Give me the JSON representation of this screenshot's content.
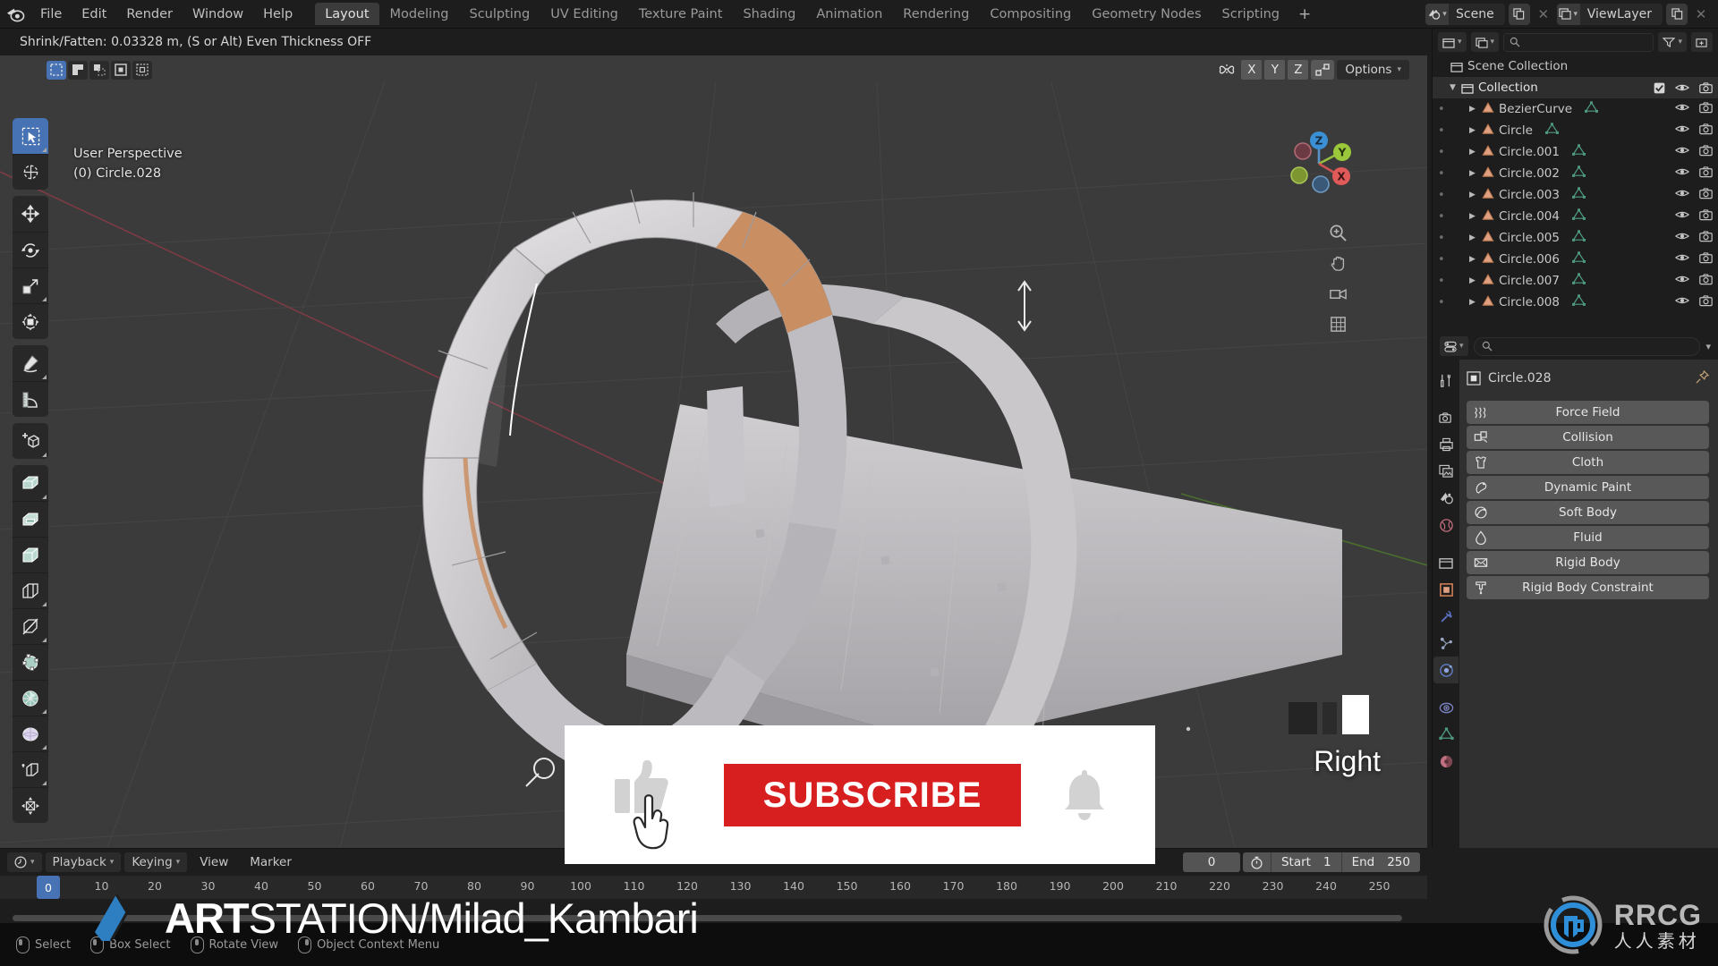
{
  "app": {
    "name": "Blender",
    "menus": [
      "File",
      "Edit",
      "Render",
      "Window",
      "Help"
    ],
    "workspace_tabs": [
      {
        "label": "Layout",
        "active": true
      },
      {
        "label": "Modeling",
        "active": false
      },
      {
        "label": "Sculpting",
        "active": false
      },
      {
        "label": "UV Editing",
        "active": false
      },
      {
        "label": "Texture Paint",
        "active": false
      },
      {
        "label": "Shading",
        "active": false
      },
      {
        "label": "Animation",
        "active": false
      },
      {
        "label": "Rendering",
        "active": false
      },
      {
        "label": "Compositing",
        "active": false
      },
      {
        "label": "Geometry Nodes",
        "active": false
      },
      {
        "label": "Scripting",
        "active": false
      }
    ],
    "add_workspace": "+",
    "scene_name": "Scene",
    "view_layer_name": "ViewLayer"
  },
  "viewport": {
    "operator_info": "Shrink/Fatten: 0.03328 m, (S or Alt) Even Thickness OFF",
    "perspective_label": "User Perspective",
    "object_label": "(0) Circle.028",
    "view_orientation_label": "Right",
    "header": {
      "axis_buttons": [
        "X",
        "Y",
        "Z"
      ],
      "options_label": "Options"
    },
    "select_modes": [
      "tweak",
      "select-box",
      "select-circle",
      "select-lasso"
    ],
    "tools": [
      "select-box-tool",
      "cursor-tool",
      "move-tool",
      "rotate-tool",
      "scale-tool",
      "transform-tool",
      "annotate-tool",
      "measure-tool",
      "add-cube-tool",
      "extrude-region-tool",
      "inset-faces-tool",
      "bevel-tool",
      "loop-cut-tool",
      "knife-tool",
      "poly-build-tool",
      "spin-tool",
      "smooth-tool",
      "edge-slide-tool",
      "shrink-fatten-tool"
    ],
    "gizmo_axes": [
      "Z",
      "Y",
      "X"
    ]
  },
  "outliner": {
    "root": "Scene Collection",
    "collection": "Collection",
    "items": [
      {
        "label": "BezierCurve",
        "type": "curve"
      },
      {
        "label": "Circle",
        "type": "curve"
      },
      {
        "label": "Circle.001",
        "type": "curve"
      },
      {
        "label": "Circle.002",
        "type": "curve"
      },
      {
        "label": "Circle.003",
        "type": "curve"
      },
      {
        "label": "Circle.004",
        "type": "curve"
      },
      {
        "label": "Circle.005",
        "type": "curve"
      },
      {
        "label": "Circle.006",
        "type": "curve"
      },
      {
        "label": "Circle.007",
        "type": "curve"
      },
      {
        "label": "Circle.008",
        "type": "curve"
      }
    ]
  },
  "properties": {
    "active_object": "Circle.028",
    "tabs": [
      "tool-tab",
      "render-tab",
      "output-tab",
      "view-layer-tab",
      "scene-tab",
      "world-tab",
      "collection-tab",
      "object-tab",
      "modifiers-tab",
      "particles-tab",
      "physics-tab",
      "constraints-tab",
      "data-tab",
      "material-tab"
    ],
    "active_tab": "physics-tab",
    "physics_buttons": [
      {
        "label": "Force Field",
        "icon": "force-field-icon"
      },
      {
        "label": "Collision",
        "icon": "collision-icon"
      },
      {
        "label": "Cloth",
        "icon": "cloth-icon"
      },
      {
        "label": "Dynamic Paint",
        "icon": "dynamic-paint-icon"
      },
      {
        "label": "Soft Body",
        "icon": "soft-body-icon"
      },
      {
        "label": "Fluid",
        "icon": "fluid-icon"
      },
      {
        "label": "Rigid Body",
        "icon": "rigid-body-icon"
      },
      {
        "label": "Rigid Body Constraint",
        "icon": "rigid-body-constraint-icon"
      }
    ]
  },
  "timeline": {
    "menus": [
      "Playback",
      "Keying",
      "View",
      "Marker"
    ],
    "current_frame": "0",
    "start_label": "Start",
    "start_value": "1",
    "end_label": "End",
    "end_value": "250",
    "ticks": [
      "10",
      "20",
      "30",
      "40",
      "50",
      "60",
      "70",
      "80",
      "90",
      "100",
      "110",
      "120",
      "130",
      "140",
      "150",
      "160",
      "170",
      "180",
      "190",
      "200",
      "210",
      "220",
      "230",
      "240",
      "250"
    ]
  },
  "statusbar": {
    "items": [
      {
        "label": "Select",
        "mouse": "left"
      },
      {
        "label": "Box Select",
        "mouse": "left-drag"
      },
      {
        "label": "Rotate View",
        "mouse": "middle"
      },
      {
        "label": "Object Context Menu",
        "mouse": "right"
      }
    ]
  },
  "overlays": {
    "subscribe_label": "SUBSCRIBE",
    "artstation_bold": "ART",
    "artstation_rest": "STATION/Milad_Kambari",
    "rrcg_name": "RRCG",
    "rrcg_sub": "人人素材"
  },
  "colors": {
    "accent_blue": "#4772b3",
    "subscribe_red": "#d81f1f",
    "panel_bg": "#1d1d1d",
    "viewport_bg": "#3b3b3b",
    "axis_x": "#e05a5a",
    "axis_y": "#9ac83a",
    "axis_z": "#3b8fd4"
  }
}
